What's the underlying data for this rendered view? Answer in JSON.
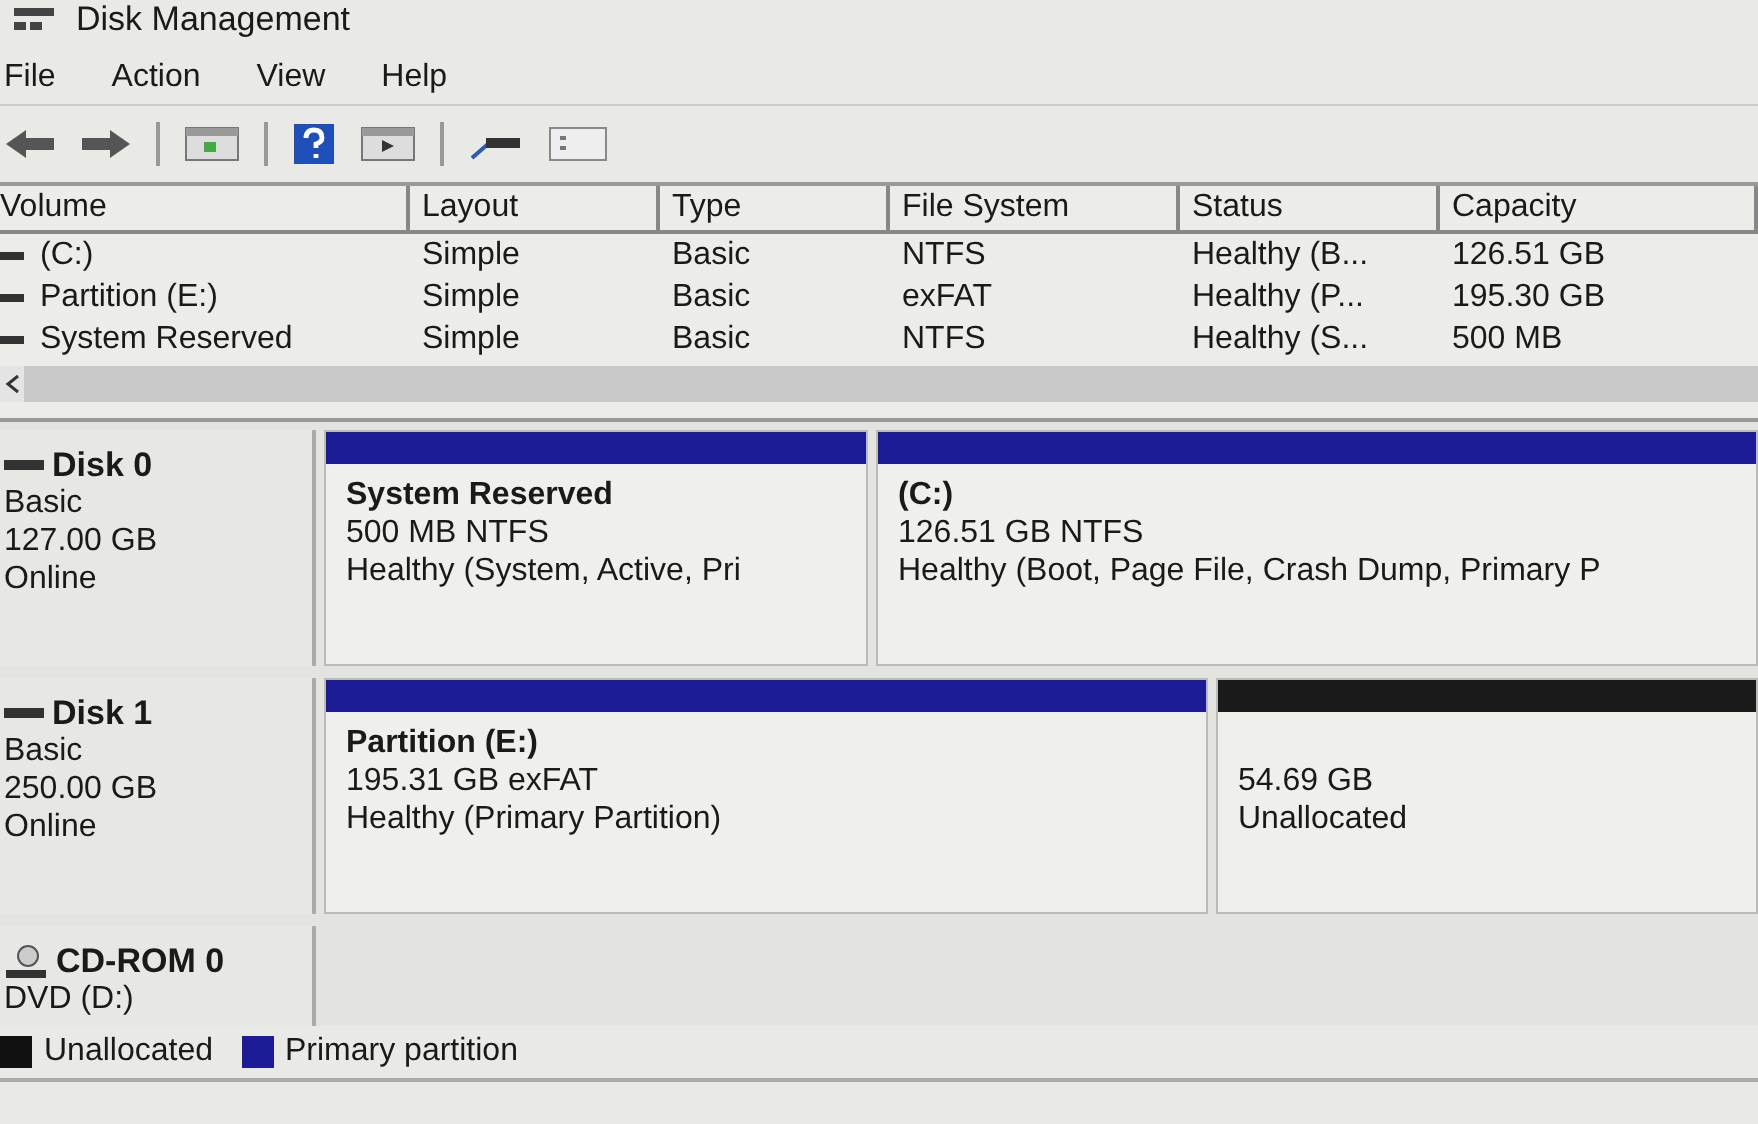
{
  "window": {
    "title": "Disk Management"
  },
  "menu": [
    "File",
    "Action",
    "View",
    "Help"
  ],
  "table": {
    "columns": [
      "Volume",
      "Layout",
      "Type",
      "File System",
      "Status",
      "Capacity"
    ],
    "rows": [
      {
        "cells": [
          "(C:)",
          "Simple",
          "Basic",
          "NTFS",
          "Healthy (B...",
          "126.51 GB"
        ]
      },
      {
        "cells": [
          "Partition (E:)",
          "Simple",
          "Basic",
          "exFAT",
          "Healthy (P...",
          "195.30 GB"
        ]
      },
      {
        "cells": [
          "System Reserved",
          "Simple",
          "Basic",
          "NTFS",
          "Healthy (S...",
          "500 MB"
        ]
      }
    ]
  },
  "disks": [
    {
      "kind": "disk",
      "name": "Disk 0",
      "type": "Basic",
      "size": "127.00 GB",
      "state": "Online",
      "partitions": [
        {
          "name": "System Reserved",
          "detail": "500 MB NTFS",
          "status": "Healthy (System, Active, Pri",
          "color": "#1c1c96"
        },
        {
          "name": "(C:)",
          "detail": "126.51 GB NTFS",
          "status": "Healthy (Boot, Page File, Crash Dump, Primary P",
          "color": "#1c1c96"
        }
      ]
    },
    {
      "kind": "disk",
      "name": "Disk 1",
      "type": "Basic",
      "size": "250.00 GB",
      "state": "Online",
      "partitions": [
        {
          "name": "Partition  (E:)",
          "detail": "195.31 GB exFAT",
          "status": "Healthy (Primary Partition)",
          "color": "#1c1c96"
        },
        {
          "detail": "54.69 GB",
          "status": "Unallocated",
          "color": "#1a1a1a"
        }
      ]
    },
    {
      "kind": "cdrom",
      "name": "CD-ROM 0",
      "type": "DVD (D:)"
    }
  ],
  "legend": [
    {
      "label": "Unallocated",
      "color": "#111111"
    },
    {
      "label": "Primary partition",
      "color": "#1c1c96"
    }
  ]
}
